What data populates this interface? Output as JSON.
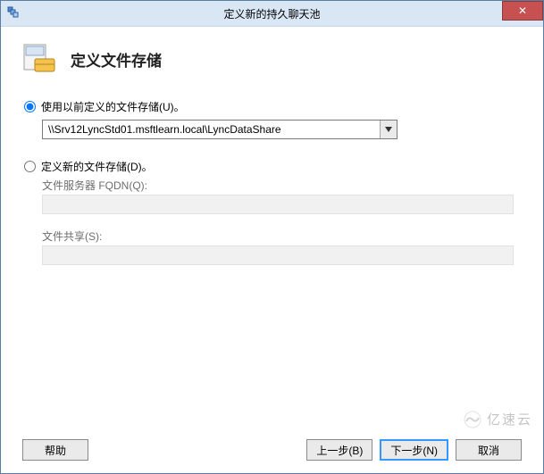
{
  "titlebar": {
    "title": "定义新的持久聊天池",
    "close_glyph": "✕"
  },
  "header": {
    "page_title": "定义文件存储"
  },
  "options": {
    "existing": {
      "label": "使用以前定义的文件存储(U)。",
      "selected": true,
      "dropdown_value": "\\\\Srv12LyncStd01.msftlearn.local\\LyncDataShare"
    },
    "new": {
      "label": "定义新的文件存储(D)。",
      "selected": false,
      "fqdn_label": "文件服务器 FQDN(Q):",
      "fqdn_value": "",
      "share_label": "文件共享(S):",
      "share_value": ""
    }
  },
  "buttons": {
    "help": "帮助",
    "back": "上一步(B)",
    "next": "下一步(N)",
    "cancel": "取消"
  },
  "watermark": {
    "text": "亿速云"
  }
}
